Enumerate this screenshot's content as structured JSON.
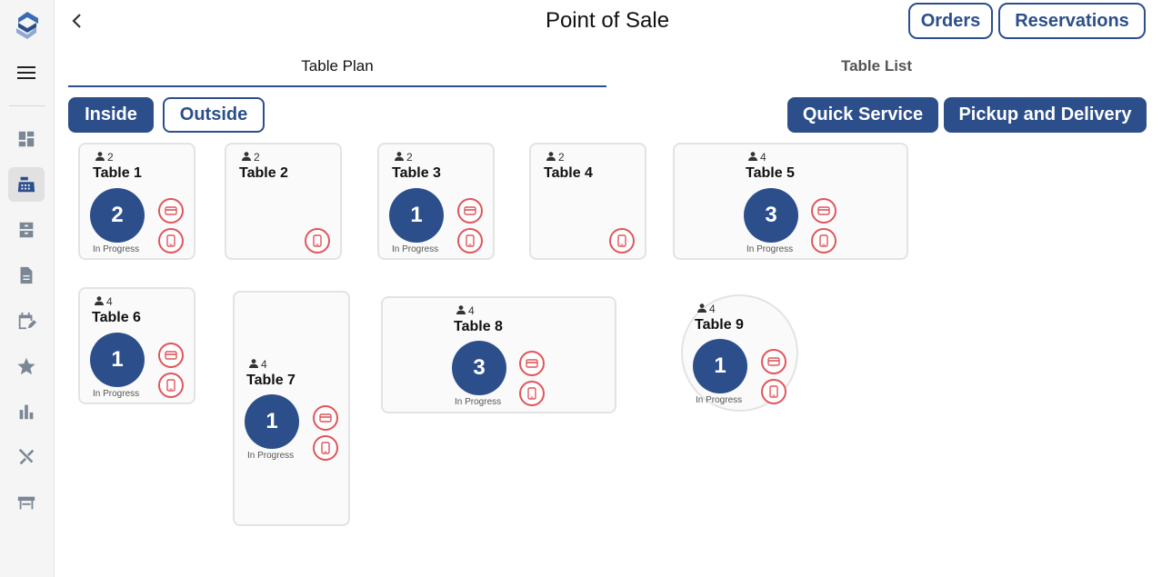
{
  "sidebar": {
    "logo_icon": "brand-s-logo",
    "menu_icon": "hamburger-menu-icon",
    "items": [
      {
        "icon": "dashboard-icon",
        "active": false
      },
      {
        "icon": "cash-register-icon",
        "active": true
      },
      {
        "icon": "cabinet-icon",
        "active": false
      },
      {
        "icon": "document-icon",
        "active": false
      },
      {
        "icon": "calendar-edit-icon",
        "active": false
      },
      {
        "icon": "star-icon",
        "active": false
      },
      {
        "icon": "bar-chart-icon",
        "active": false
      },
      {
        "icon": "utensils-icon",
        "active": false
      },
      {
        "icon": "table-icon",
        "active": false
      }
    ]
  },
  "header": {
    "title": "Point of Sale",
    "orders_label": "Orders",
    "reservations_label": "Reservations"
  },
  "tabs": [
    {
      "label": "Table Plan",
      "active": true
    },
    {
      "label": "Table List",
      "active": false
    }
  ],
  "areas": {
    "inside_label": "Inside",
    "outside_label": "Outside",
    "selected": "Inside"
  },
  "actions": {
    "quick_service_label": "Quick Service",
    "pickup_delivery_label": "Pickup and Delivery"
  },
  "tables": [
    {
      "name": "Table 1",
      "seats": "2",
      "count": "2",
      "status": "In Progress",
      "shape": "square"
    },
    {
      "name": "Table 2",
      "seats": "2",
      "count": "",
      "status": "",
      "shape": "square"
    },
    {
      "name": "Table 3",
      "seats": "2",
      "count": "1",
      "status": "In Progress",
      "shape": "square"
    },
    {
      "name": "Table 4",
      "seats": "2",
      "count": "",
      "status": "",
      "shape": "square"
    },
    {
      "name": "Table 5",
      "seats": "4",
      "count": "3",
      "status": "In Progress",
      "shape": "wide"
    },
    {
      "name": "Table 6",
      "seats": "4",
      "count": "1",
      "status": "In Progress",
      "shape": "square"
    },
    {
      "name": "Table 7",
      "seats": "4",
      "count": "1",
      "status": "In Progress",
      "shape": "tall"
    },
    {
      "name": "Table 8",
      "seats": "4",
      "count": "3",
      "status": "In Progress",
      "shape": "wide"
    },
    {
      "name": "Table 9",
      "seats": "4",
      "count": "1",
      "status": "In Progress",
      "shape": "round"
    }
  ],
  "colors": {
    "primary": "#2c4f8c",
    "accent_red": "#e0555b",
    "sidebar_bg": "#f5f5f5"
  },
  "icons": {
    "seats": "person-icon",
    "payment": "credit-card-icon",
    "device": "tablet-icon"
  }
}
